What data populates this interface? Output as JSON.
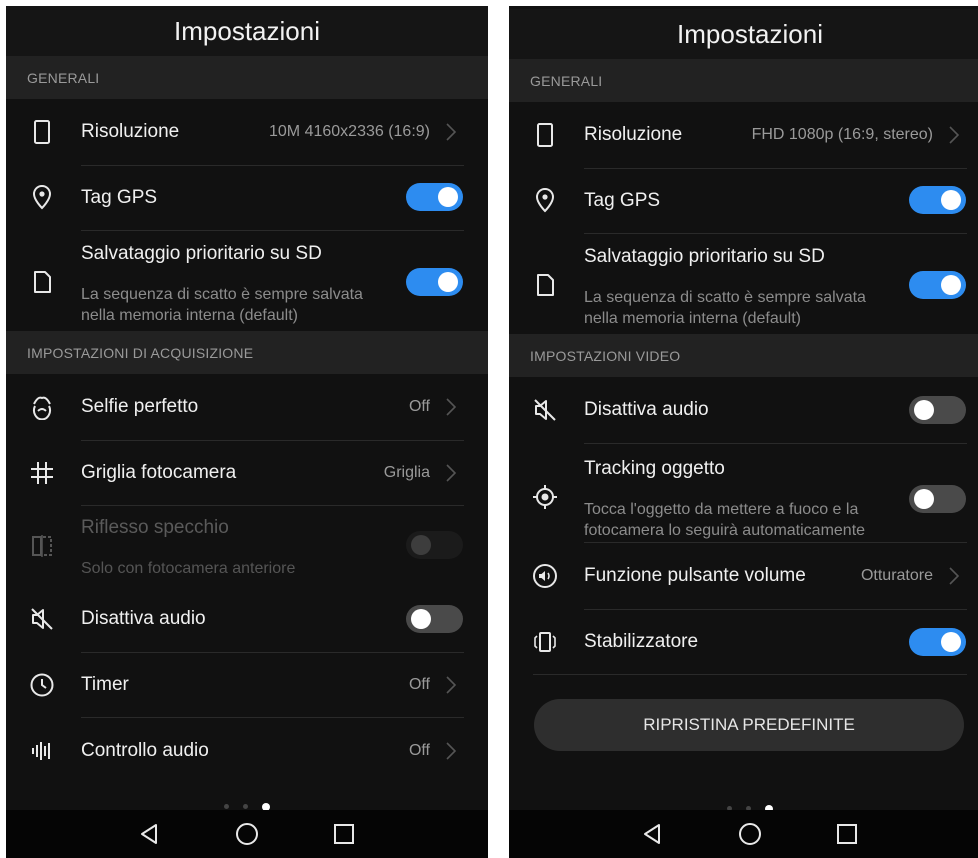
{
  "left": {
    "title": "Impostazioni",
    "sections": {
      "general": "GENERALI",
      "capture": "IMPOSTAZIONI DI ACQUISIZIONE"
    },
    "resolution": {
      "label": "Risoluzione",
      "value": "10M 4160x2336 (16:9)",
      "icon": "portrait-rect-icon"
    },
    "gps": {
      "label": "Tag GPS",
      "icon": "location-pin-icon",
      "state": "on"
    },
    "sd": {
      "label": "Salvataggio prioritario su SD",
      "sub1": "La sequenza di scatto è sempre salvata",
      "sub2": "nella memoria interna (default)",
      "icon": "sd-card-icon",
      "state": "on"
    },
    "selfie": {
      "label": "Selfie perfetto",
      "value": "Off",
      "icon": "face-icon"
    },
    "grid": {
      "label": "Griglia fotocamera",
      "value": "Griglia",
      "icon": "hash-grid-icon"
    },
    "mirror": {
      "label": "Riflesso specchio",
      "sub": "Solo con fotocamera anteriore",
      "icon": "mirror-icon",
      "state": "disabled"
    },
    "mute": {
      "label": "Disattiva audio",
      "icon": "muted-speaker-icon",
      "state": "off"
    },
    "timer": {
      "label": "Timer",
      "value": "Off",
      "icon": "clock-icon"
    },
    "audio_control": {
      "label": "Controllo audio",
      "value": "Off",
      "icon": "audio-bars-icon"
    }
  },
  "right": {
    "title": "Impostazioni",
    "sections": {
      "general": "GENERALI",
      "video": "IMPOSTAZIONI VIDEO"
    },
    "resolution": {
      "label": "Risoluzione",
      "value": "FHD 1080p (16:9, stereo)",
      "icon": "portrait-rect-icon"
    },
    "gps": {
      "label": "Tag GPS",
      "icon": "location-pin-icon",
      "state": "on"
    },
    "sd": {
      "label": "Salvataggio prioritario su SD",
      "sub1": "La sequenza di scatto è sempre salvata",
      "sub2": "nella memoria interna (default)",
      "icon": "sd-card-icon",
      "state": "on"
    },
    "mute": {
      "label": "Disattiva audio",
      "icon": "muted-speaker-icon",
      "state": "off"
    },
    "tracking": {
      "label": "Tracking oggetto",
      "sub1": "Tocca l'oggetto da mettere a fuoco e la",
      "sub2": "fotocamera lo seguirà automaticamente",
      "icon": "target-icon",
      "state": "off"
    },
    "volume_key": {
      "label": "Funzione pulsante volume",
      "value": "Otturatore",
      "icon": "volume-icon"
    },
    "stabilizer": {
      "label": "Stabilizzatore",
      "icon": "stabilizer-icon",
      "state": "on"
    },
    "reset_label": "RIPRISTINA PREDEFINITE"
  },
  "page_indicator": {
    "pages": 3,
    "current": 3
  },
  "colors": {
    "accent": "#2d8cf0",
    "background": "#111111",
    "section": "#222222"
  }
}
